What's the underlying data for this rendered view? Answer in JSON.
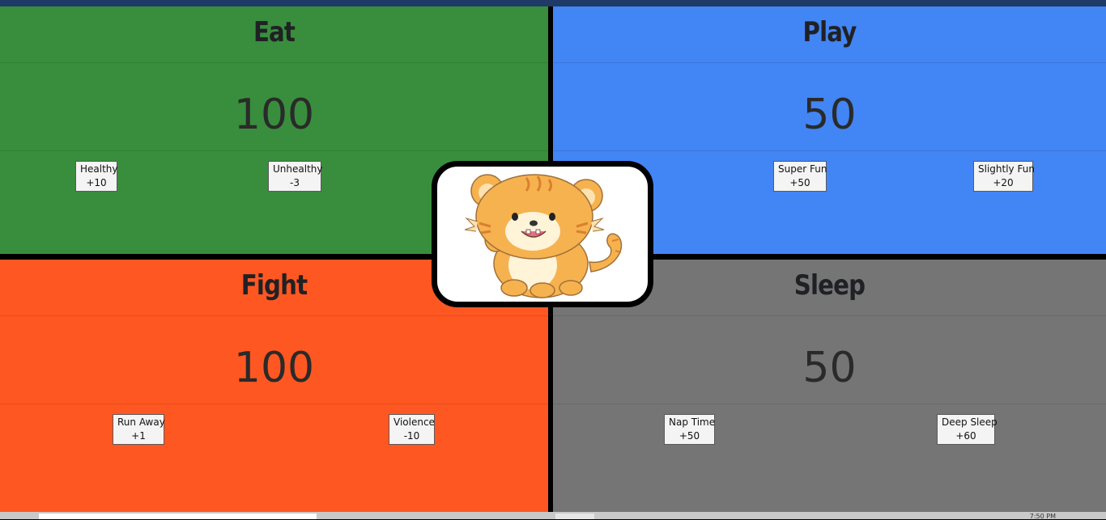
{
  "stats": {
    "eat": {
      "title": "Eat",
      "value": "100",
      "color": "#388e3c",
      "buttons": [
        {
          "label": "Healthy",
          "delta": "+10"
        },
        {
          "label": "Unhealthy",
          "delta": "-3"
        }
      ]
    },
    "play": {
      "title": "Play",
      "value": "50",
      "color": "#4285f4",
      "buttons": [
        {
          "label": "Super Fun",
          "delta": "+50"
        },
        {
          "label": "Slightly Fun",
          "delta": "+20"
        }
      ]
    },
    "fight": {
      "title": "Fight",
      "value": "100",
      "color": "#ff5722",
      "buttons": [
        {
          "label": "Run Away",
          "delta": "+1"
        },
        {
          "label": "Violence",
          "delta": "-10"
        }
      ]
    },
    "sleep": {
      "title": "Sleep",
      "value": "50",
      "color": "#757575",
      "buttons": [
        {
          "label": "Nap Time",
          "delta": "+50"
        },
        {
          "label": "Deep Sleep",
          "delta": "+60"
        }
      ]
    }
  },
  "pet": {
    "icon": "tiger-cub-icon"
  },
  "taskbar": {
    "clock": "7:50 PM"
  }
}
